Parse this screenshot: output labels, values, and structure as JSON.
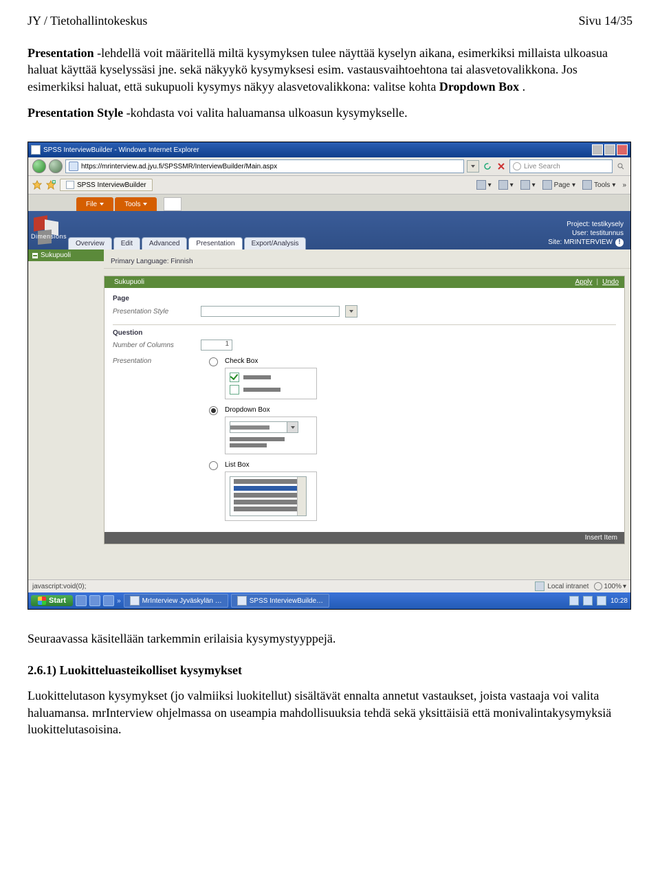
{
  "header": {
    "left": "JY / Tietohallintokeskus",
    "right": "Sivu 14/35"
  },
  "para1": {
    "part1_b": "Presentation",
    "part1": " -lehdellä voit määritellä miltä kysymyksen tulee näyttää kyselyn aikana, esimerkiksi millaista ulkoasua haluat käyttää kyselyssäsi jne. sekä näkyykö kysymyksesi esim. vastausvaihtoehtona tai alasvetovalikkona. Jos esimerkiksi haluat, että sukupuoli kysymys näkyy alasvetovalikkona: valitse kohta ",
    "part1_b2": "Dropdown Box",
    "part1_end": " ."
  },
  "para2": {
    "b": "Presentation Style",
    "rest": " -kohdasta voi valita haluamansa ulkoasun kysymykselle."
  },
  "para3": "Seuraavassa käsitellään tarkemmin erilaisia kysymystyyppejä.",
  "heading": "2.6.1) Luokitteluasteikolliset kysymykset",
  "para4": "Luokittelutason kysymykset (jo valmiiksi luokitellut) sisältävät ennalta annetut vastaukset, joista vastaaja voi valita haluamansa. mrInterview ohjelmassa on useampia mahdollisuuksia tehdä sekä yksittäisiä että monivalintakysymyksiä luokittelutasoisina.",
  "ie": {
    "title": "SPSS InterviewBuilder - Windows Internet Explorer",
    "url": "https://mrinterview.ad.jyu.fi/SPSSMR/InterviewBuilder/Main.aspx",
    "search_placeholder": "Live Search",
    "tab": "SPSS InterviewBuilder",
    "tool_page": "Page",
    "tool_tools": "Tools",
    "status_left": "javascript:void(0);",
    "zone": "Local intranet",
    "zoom": "100%"
  },
  "app": {
    "menu_file": "File",
    "menu_tools": "Tools",
    "dimensions": "Dimensions",
    "tabs": [
      "Overview",
      "Edit",
      "Advanced",
      "Presentation",
      "Export/Analysis"
    ],
    "proj": "Project: testikysely",
    "user": "User: testitunnus",
    "site": "Site: MRINTERVIEW",
    "sidebar_item": "Sukupuoli",
    "primary_lang": "Primary Language: Finnish",
    "q_title": "Sukupuoli",
    "apply": "Apply",
    "undo": "Undo",
    "sec_page": "Page",
    "lbl_pres_style": "Presentation Style",
    "sec_question": "Question",
    "lbl_num_cols": "Number of Columns",
    "num_cols_val": "1",
    "lbl_presentation": "Presentation",
    "opt_checkbox": "Check Box",
    "opt_dropdown": "Dropdown Box",
    "opt_listbox": "List Box",
    "insert_item": "Insert Item"
  },
  "taskbar": {
    "start": "Start",
    "item1": "MrInterview Jyväskylän …",
    "item2": "SPSS InterviewBuilde…",
    "time": "10:28"
  }
}
